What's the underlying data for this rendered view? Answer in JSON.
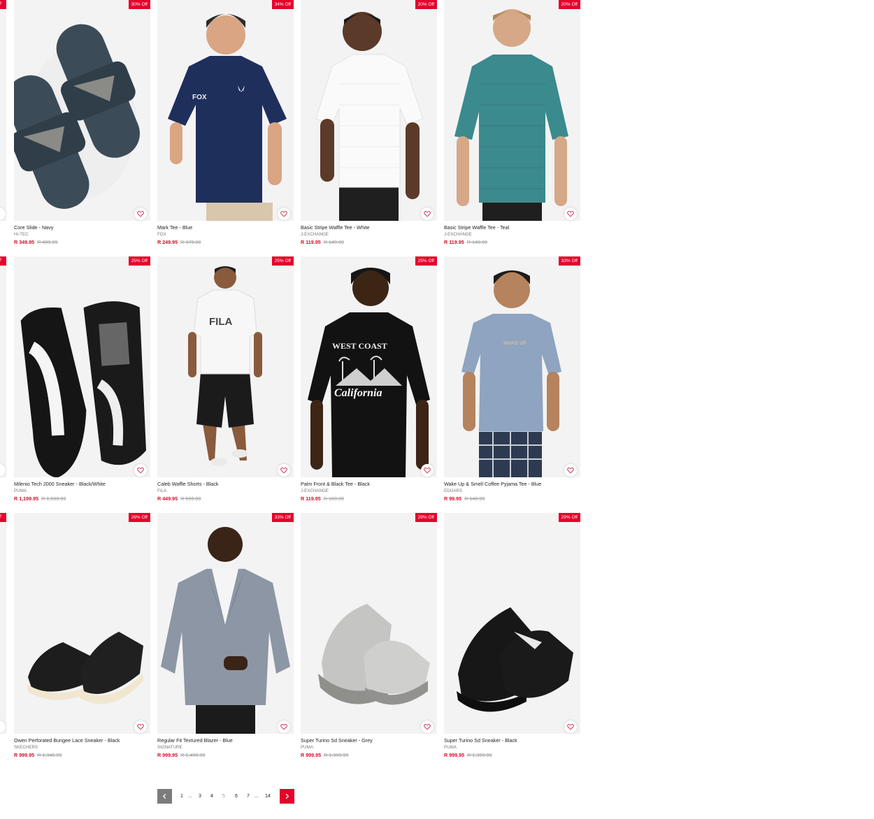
{
  "edge_badge_label": "Off",
  "products": [
    {
      "name": "Core Slide - Navy",
      "brand": "HI-TEC",
      "price": "R 349.95",
      "was": "R 499.99",
      "badge": "30% Off",
      "img": "slides"
    },
    {
      "name": "Mark Tee - Blue",
      "brand": "FOX",
      "price": "R 249.95",
      "was": "R 379.00",
      "badge": "34% Off",
      "img": "tee-navy"
    },
    {
      "name": "Basic Stripe Waffle Tee - White",
      "brand": "J-EXCHANGE",
      "price": "R 119.95",
      "was": "R 149.99",
      "badge": "20% Off",
      "img": "tee-white"
    },
    {
      "name": "Basic Stripe Waffle Tee - Teal",
      "brand": "J-EXCHANGE",
      "price": "R 119.95",
      "was": "R 149.99",
      "badge": "20% Off",
      "img": "tee-teal"
    },
    {
      "name": "Milenio Tech 2000 Sneaker - Black/White",
      "brand": "PUMA",
      "price": "R 1,199.95",
      "was": "R 1,599.99",
      "badge": "25% Off",
      "img": "sneaker-bw"
    },
    {
      "name": "Caleb Waffle Shorts - Black",
      "brand": "FILA",
      "price": "R 449.95",
      "was": "R 599.99",
      "badge": "25% Off",
      "img": "shorts"
    },
    {
      "name": "Palm Front & Black Tee - Black",
      "brand": "J-EXCHANGE",
      "price": "R 119.95",
      "was": "R 159.99",
      "badge": "25% Off",
      "img": "tee-black"
    },
    {
      "name": "Wake Up & Smell Coffee Pyjama Tee - Blue",
      "brand": "EDGARS",
      "price": "R 99.95",
      "was": "R 149.99",
      "badge": "33% Off",
      "img": "pyjama"
    },
    {
      "name": "Owen Perforated Bungee Lace Sneaker - Black",
      "brand": "SKECHERS",
      "price": "R 999.95",
      "was": "R 1,349.99",
      "badge": "26% Off",
      "img": "sneaker-black-cream"
    },
    {
      "name": "Regular Fit Textured Blazer - Blue",
      "brand": "SIGNATURE",
      "price": "R 999.95",
      "was": "R 1,499.99",
      "badge": "33% Off",
      "img": "blazer"
    },
    {
      "name": "Super Turino Sd Sneaker - Grey",
      "brand": "PUMA",
      "price": "R 999.95",
      "was": "R 1,399.99",
      "badge": "29% Off",
      "img": "sneaker-grey"
    },
    {
      "name": "Super Turino Sd Sneaker - Black",
      "brand": "PUMA",
      "price": "R 999.95",
      "was": "R 1,399.99",
      "badge": "29% Off",
      "img": "sneaker-black"
    }
  ],
  "image_text": {
    "fox": "FOX",
    "fila": "FILA",
    "westcoast": "WEST COAST",
    "california": "California",
    "wake": "WAKE UP"
  },
  "pagination": {
    "pages": [
      "1",
      "3",
      "4",
      "5",
      "6",
      "7",
      "14"
    ],
    "ellipsis": "...",
    "current": "5"
  },
  "colors": {
    "accent": "#e4032b",
    "price": "#d5102d",
    "prev_button": "#7c7c7c"
  }
}
